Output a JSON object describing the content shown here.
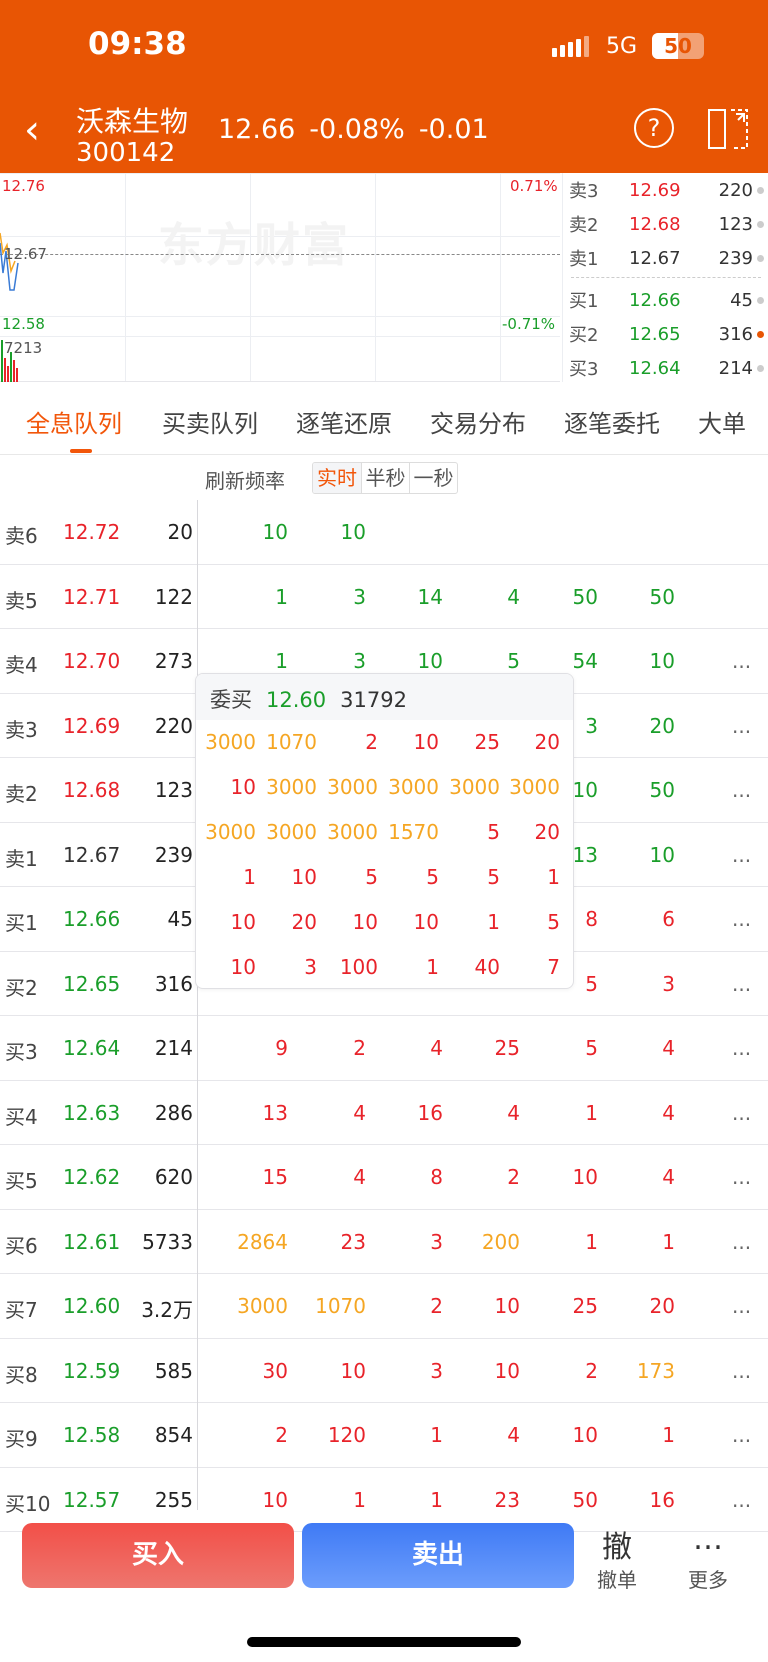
{
  "status": {
    "time": "09:38",
    "network": "5G",
    "battery": "50"
  },
  "header": {
    "name": "沃森生物",
    "code": "300142",
    "price": "12.66",
    "change_pct": "-0.08%",
    "change": "-0.01",
    "back_icon": "chevron-left-icon",
    "help_icon": "question-circle-icon",
    "switch_icon": "split-screen-icon"
  },
  "chart": {
    "watermark": "东方财富",
    "high": "12.76",
    "mid": "12.67",
    "low": "12.58",
    "volume": "7213",
    "high_pct": "0.71%",
    "low_pct": "-0.71%"
  },
  "orderbook": [
    {
      "label": "卖3",
      "price": "12.69",
      "qty": "220",
      "pc": "r",
      "dot": "#cccccc"
    },
    {
      "label": "卖2",
      "price": "12.68",
      "qty": "123",
      "pc": "r",
      "dot": "#cccccc"
    },
    {
      "label": "卖1",
      "price": "12.67",
      "qty": "239",
      "pc": "k",
      "dot": "#cccccc"
    },
    {
      "label": "买1",
      "price": "12.66",
      "qty": "45",
      "pc": "g",
      "dot": "#cccccc"
    },
    {
      "label": "买2",
      "price": "12.65",
      "qty": "316",
      "pc": "g",
      "dot": "#e85504"
    },
    {
      "label": "买3",
      "price": "12.64",
      "qty": "214",
      "pc": "g",
      "dot": "#cccccc"
    }
  ],
  "tabs": [
    "全息队列",
    "买卖队列",
    "逐笔还原",
    "交易分布",
    "逐笔委托",
    "大单"
  ],
  "active_tab": 0,
  "refresh": {
    "label": "刷新频率",
    "options": [
      "实时",
      "半秒",
      "一秒"
    ],
    "selected": "实时"
  },
  "colors": {
    "red": "#e8232a",
    "green": "#1a9e2a",
    "orange": "#f5a623",
    "accent": "#e85504"
  },
  "rows": [
    {
      "label": "卖6",
      "price": "12.72",
      "pc": "r",
      "vol": "20",
      "more": false,
      "cells": [
        [
          "10",
          "g"
        ],
        [
          "10",
          "g"
        ],
        null,
        null,
        null,
        null
      ]
    },
    {
      "label": "卖5",
      "price": "12.71",
      "pc": "r",
      "vol": "122",
      "more": false,
      "cells": [
        [
          "1",
          "g"
        ],
        [
          "3",
          "g"
        ],
        [
          "14",
          "g"
        ],
        [
          "4",
          "g"
        ],
        [
          "50",
          "g"
        ],
        [
          "50",
          "g"
        ]
      ]
    },
    {
      "label": "卖4",
      "price": "12.70",
      "pc": "r",
      "vol": "273",
      "more": true,
      "cells": [
        [
          "1",
          "g"
        ],
        [
          "3",
          "g"
        ],
        [
          "10",
          "g"
        ],
        [
          "5",
          "g"
        ],
        [
          "54",
          "g"
        ],
        [
          "10",
          "g"
        ]
      ]
    },
    {
      "label": "卖3",
      "price": "12.69",
      "pc": "r",
      "vol": "220",
      "more": true,
      "cells": [
        null,
        null,
        null,
        null,
        [
          "3",
          "g"
        ],
        [
          "20",
          "g"
        ]
      ]
    },
    {
      "label": "卖2",
      "price": "12.68",
      "pc": "r",
      "vol": "123",
      "more": true,
      "cells": [
        null,
        null,
        null,
        null,
        [
          "10",
          "g"
        ],
        [
          "50",
          "g"
        ]
      ]
    },
    {
      "label": "卖1",
      "price": "12.67",
      "pc": "k",
      "vol": "239",
      "more": true,
      "cells": [
        null,
        null,
        null,
        null,
        [
          "13",
          "g"
        ],
        [
          "10",
          "g"
        ]
      ]
    },
    {
      "label": "买1",
      "price": "12.66",
      "pc": "g",
      "vol": "45",
      "more": true,
      "cells": [
        null,
        null,
        null,
        null,
        [
          "8",
          "r"
        ],
        [
          "6",
          "r"
        ]
      ]
    },
    {
      "label": "买2",
      "price": "12.65",
      "pc": "g",
      "vol": "316",
      "more": true,
      "cells": [
        null,
        null,
        null,
        null,
        [
          "5",
          "r"
        ],
        [
          "3",
          "r"
        ]
      ]
    },
    {
      "label": "买3",
      "price": "12.64",
      "pc": "g",
      "vol": "214",
      "more": true,
      "cells": [
        [
          "9",
          "r"
        ],
        [
          "2",
          "r"
        ],
        [
          "4",
          "r"
        ],
        [
          "25",
          "r"
        ],
        [
          "5",
          "r"
        ],
        [
          "4",
          "r"
        ]
      ]
    },
    {
      "label": "买4",
      "price": "12.63",
      "pc": "g",
      "vol": "286",
      "more": true,
      "cells": [
        [
          "13",
          "r"
        ],
        [
          "4",
          "r"
        ],
        [
          "16",
          "r"
        ],
        [
          "4",
          "r"
        ],
        [
          "1",
          "r"
        ],
        [
          "4",
          "r"
        ]
      ]
    },
    {
      "label": "买5",
      "price": "12.62",
      "pc": "g",
      "vol": "620",
      "more": true,
      "cells": [
        [
          "15",
          "r"
        ],
        [
          "4",
          "r"
        ],
        [
          "8",
          "r"
        ],
        [
          "2",
          "r"
        ],
        [
          "10",
          "r"
        ],
        [
          "4",
          "r"
        ]
      ]
    },
    {
      "label": "买6",
      "price": "12.61",
      "pc": "g",
      "vol": "5733",
      "more": true,
      "cells": [
        [
          "2864",
          "o"
        ],
        [
          "23",
          "r"
        ],
        [
          "3",
          "r"
        ],
        [
          "200",
          "o"
        ],
        [
          "1",
          "r"
        ],
        [
          "1",
          "r"
        ]
      ]
    },
    {
      "label": "买7",
      "price": "12.60",
      "pc": "g",
      "vol": "3.2万",
      "more": true,
      "cells": [
        [
          "3000",
          "o"
        ],
        [
          "1070",
          "o"
        ],
        [
          "2",
          "r"
        ],
        [
          "10",
          "r"
        ],
        [
          "25",
          "r"
        ],
        [
          "20",
          "r"
        ]
      ]
    },
    {
      "label": "买8",
      "price": "12.59",
      "pc": "g",
      "vol": "585",
      "more": true,
      "cells": [
        [
          "30",
          "r"
        ],
        [
          "10",
          "r"
        ],
        [
          "3",
          "r"
        ],
        [
          "10",
          "r"
        ],
        [
          "2",
          "r"
        ],
        [
          "173",
          "o"
        ]
      ]
    },
    {
      "label": "买9",
      "price": "12.58",
      "pc": "g",
      "vol": "854",
      "more": true,
      "cells": [
        [
          "2",
          "r"
        ],
        [
          "120",
          "r"
        ],
        [
          "1",
          "r"
        ],
        [
          "4",
          "r"
        ],
        [
          "10",
          "r"
        ],
        [
          "1",
          "r"
        ]
      ]
    },
    {
      "label": "买10",
      "price": "12.57",
      "pc": "g",
      "vol": "255",
      "more": true,
      "cells": [
        [
          "10",
          "r"
        ],
        [
          "1",
          "r"
        ],
        [
          "1",
          "r"
        ],
        [
          "23",
          "r"
        ],
        [
          "50",
          "r"
        ],
        [
          "16",
          "r"
        ]
      ]
    }
  ],
  "more_text": "...",
  "popup": {
    "title": "委买",
    "price": "12.60",
    "total": "31792",
    "rows": [
      [
        [
          "3000",
          "o"
        ],
        [
          "1070",
          "o"
        ],
        [
          "2",
          "r"
        ],
        [
          "10",
          "r"
        ],
        [
          "25",
          "r"
        ],
        [
          "20",
          "r"
        ]
      ],
      [
        [
          "10",
          "r"
        ],
        [
          "3000",
          "o"
        ],
        [
          "3000",
          "o"
        ],
        [
          "3000",
          "o"
        ],
        [
          "3000",
          "o"
        ],
        [
          "3000",
          "o"
        ]
      ],
      [
        [
          "3000",
          "o"
        ],
        [
          "3000",
          "o"
        ],
        [
          "3000",
          "o"
        ],
        [
          "1570",
          "o"
        ],
        [
          "5",
          "r"
        ],
        [
          "20",
          "r"
        ]
      ],
      [
        [
          "1",
          "r"
        ],
        [
          "10",
          "r"
        ],
        [
          "5",
          "r"
        ],
        [
          "5",
          "r"
        ],
        [
          "5",
          "r"
        ],
        [
          "1",
          "r"
        ]
      ],
      [
        [
          "10",
          "r"
        ],
        [
          "20",
          "r"
        ],
        [
          "10",
          "r"
        ],
        [
          "10",
          "r"
        ],
        [
          "1",
          "r"
        ],
        [
          "5",
          "r"
        ]
      ],
      [
        [
          "10",
          "r"
        ],
        [
          "3",
          "r"
        ],
        [
          "100",
          "r"
        ],
        [
          "1",
          "r"
        ],
        [
          "40",
          "r"
        ],
        [
          "7",
          "r"
        ]
      ]
    ]
  },
  "footer": {
    "buy": "买入",
    "sell": "卖出",
    "cancel_icon_text": "撤",
    "cancel": "撤单",
    "more": "更多"
  }
}
